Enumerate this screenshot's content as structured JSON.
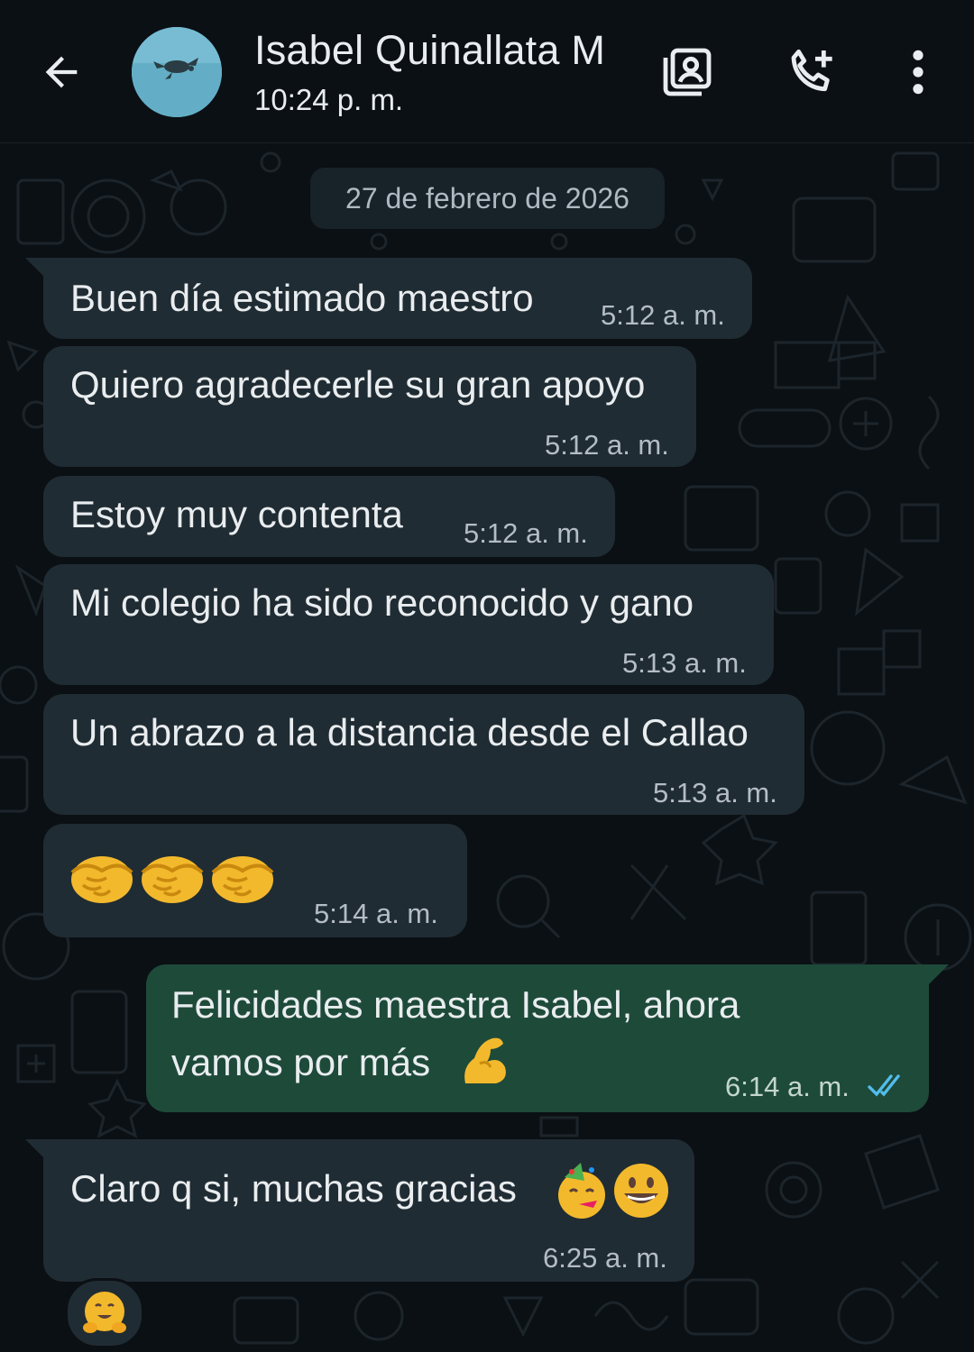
{
  "header": {
    "contact_name": "Isabel Quinallata M",
    "status": "10:24 p. m."
  },
  "chat": {
    "date_separator": "27 de febrero de 2026",
    "messages": [
      {
        "direction": "in",
        "text": "Buen día estimado maestro",
        "time": "5:12 a. m."
      },
      {
        "direction": "in",
        "text": "Quiero agradecerle su gran apoyo",
        "time": "5:12 a. m."
      },
      {
        "direction": "in",
        "text": "Estoy muy contenta",
        "time": "5:12 a. m."
      },
      {
        "direction": "in",
        "text": "Mi colegio ha sido reconocido  y gano",
        "time": "5:13 a. m."
      },
      {
        "direction": "in",
        "text": "Un abrazo a la distancia desde el Callao",
        "time": "5:13 a. m."
      },
      {
        "direction": "in",
        "text": "",
        "emoji": [
          "handshake-emoji",
          "handshake-emoji",
          "handshake-emoji"
        ],
        "time": "5:14 a. m."
      },
      {
        "direction": "out",
        "text_lines": [
          "Felicidades maestra Isabel, ahora",
          "vamos por más"
        ],
        "emoji": [
          "flexed-biceps-emoji"
        ],
        "time": "6:14 a. m.",
        "status": "read",
        "status_icon": "double-check-icon"
      },
      {
        "direction": "in",
        "text": "Claro q si, muchas gracias",
        "emoji": [
          "partying-face-emoji",
          "grinning-face-emoji"
        ],
        "time": "6:25 a. m.",
        "reaction": "hugging-face-emoji"
      }
    ]
  },
  "colors": {
    "background": "#0b1014",
    "incoming_bubble": "#202c33",
    "outgoing_bubble": "#1e4a3a",
    "read_ticks": "#53bdeb",
    "avatar_bg": "#6ab0c8"
  },
  "icons": {
    "back": "arrow-left-icon",
    "contact_card": "contact-card-icon",
    "call": "add-call-icon",
    "menu": "more-vert-icon"
  }
}
